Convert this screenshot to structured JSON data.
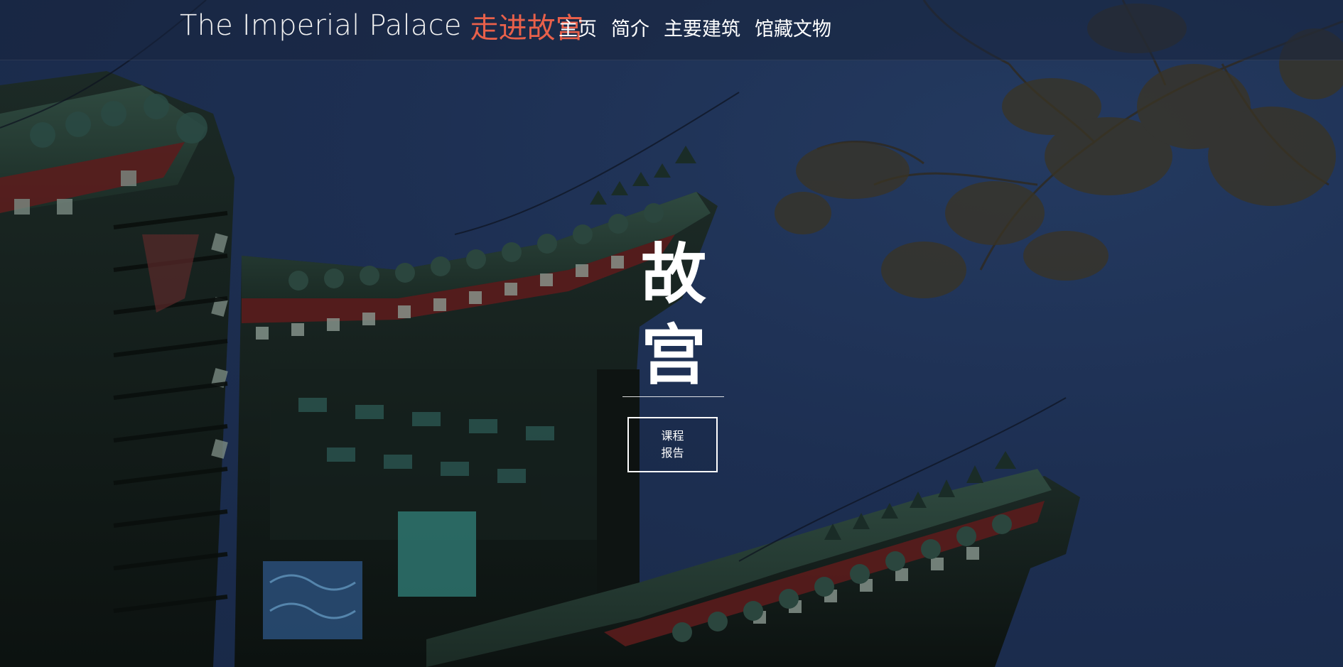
{
  "header": {
    "brand_en": "The Imperial Palace",
    "brand_cn": "走进故宫",
    "nav": [
      {
        "label": "主页"
      },
      {
        "label": "简介"
      },
      {
        "label": "主要建筑"
      },
      {
        "label": "馆藏文物"
      }
    ]
  },
  "hero": {
    "title": "故宫",
    "button_label": "课程报告",
    "background": "dark blue night photo of Forbidden City palace roof eaves and tree branches"
  },
  "colors": {
    "accent": "#e8604a",
    "text": "#ffffff",
    "sky": "#1d2f52"
  }
}
